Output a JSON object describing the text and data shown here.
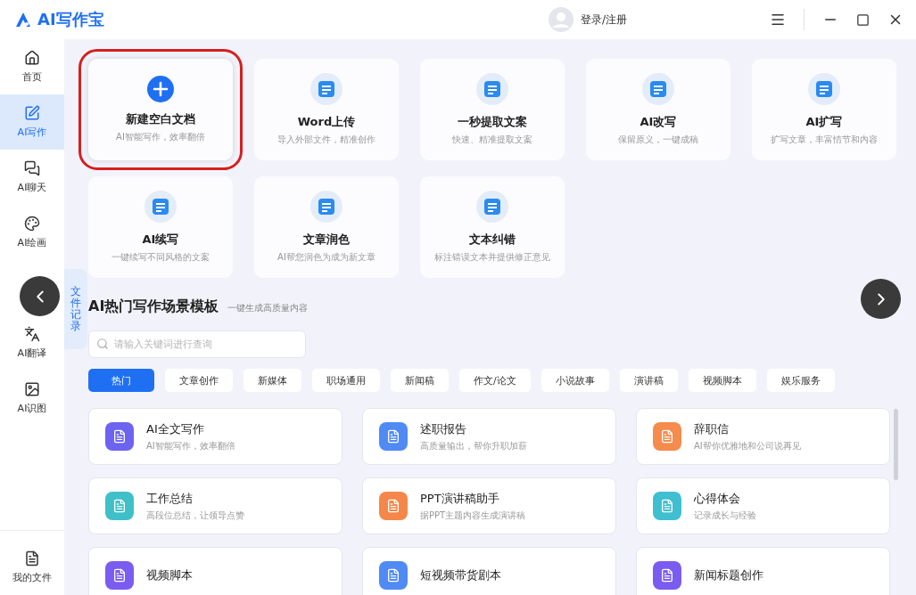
{
  "app": {
    "title": "AI写作宝"
  },
  "header": {
    "login": "登录/注册"
  },
  "sidebar": {
    "items": [
      {
        "label": "首页",
        "selected": false
      },
      {
        "label": "AI写作",
        "selected": true
      },
      {
        "label": "AI聊天",
        "selected": false
      },
      {
        "label": "AI绘画",
        "selected": false
      },
      {
        "label": "AI翻译",
        "selected": false
      },
      {
        "label": "AI识图",
        "selected": false
      }
    ],
    "bottom": {
      "label": "我的文件"
    }
  },
  "file_record_tab": {
    "label": "文件记录"
  },
  "tools": [
    {
      "title": "新建空白文档",
      "subtitle": "AI智能写作，效率翻倍",
      "highlighted": true
    },
    {
      "title": "Word上传",
      "subtitle": "导入外部文件，精准创作",
      "highlighted": false
    },
    {
      "title": "一秒提取文案",
      "subtitle": "快速、精准提取文案",
      "highlighted": false
    },
    {
      "title": "AI改写",
      "subtitle": "保留原义，一键成稿",
      "highlighted": false
    },
    {
      "title": "AI扩写",
      "subtitle": "扩写文章，丰富情节和内容",
      "highlighted": false
    },
    {
      "title": "AI续写",
      "subtitle": "一键续写不同风格的文案",
      "highlighted": false
    },
    {
      "title": "文章润色",
      "subtitle": "AI帮您润色为成为新文章",
      "highlighted": false
    },
    {
      "title": "文本纠错",
      "subtitle": "标注错误文本并提供修正意见",
      "highlighted": false
    }
  ],
  "templates_section": {
    "title": "AI热门写作场景模板",
    "subtitle": "一键生成高质量内容",
    "search": {
      "placeholder": "请输入关键词进行查询"
    },
    "tabs": [
      {
        "label": "热门",
        "selected": true
      },
      {
        "label": "文章创作",
        "selected": false
      },
      {
        "label": "新媒体",
        "selected": false
      },
      {
        "label": "职场通用",
        "selected": false
      },
      {
        "label": "新闻稿",
        "selected": false
      },
      {
        "label": "作文/论文",
        "selected": false
      },
      {
        "label": "小说故事",
        "selected": false
      },
      {
        "label": "演讲稿",
        "selected": false
      },
      {
        "label": "视频脚本",
        "selected": false
      },
      {
        "label": "娱乐服务",
        "selected": false
      }
    ],
    "items": [
      {
        "title": "AI全文写作",
        "subtitle": "AI智能写作，效率翻倍",
        "color": "#6c63f0"
      },
      {
        "title": "述职报告",
        "subtitle": "高质量输出，帮你升职加薪",
        "color": "#4f8af5"
      },
      {
        "title": "辞职信",
        "subtitle": "AI帮你优雅地和公司说再见",
        "color": "#f58b4c"
      },
      {
        "title": "工作总结",
        "subtitle": "高段位总结，让领导点赞",
        "color": "#3fc0c8"
      },
      {
        "title": "PPT演讲稿助手",
        "subtitle": "据PPT主题内容生成演讲稿",
        "color": "#f5874a"
      },
      {
        "title": "心得体会",
        "subtitle": "记录成长与经验",
        "color": "#3fbfcf"
      },
      {
        "title": "视频脚本",
        "color": "#7a5cf0"
      },
      {
        "title": "短视频带货剧本",
        "color": "#4f8af5"
      },
      {
        "title": "新闻标题创作",
        "color": "#7a5cf0"
      }
    ]
  }
}
